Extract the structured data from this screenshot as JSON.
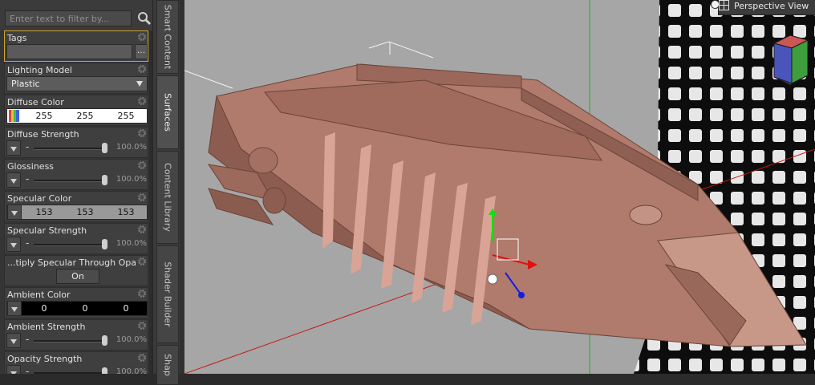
{
  "filter": {
    "placeholder": "Enter text to filter by..."
  },
  "properties": {
    "tags": {
      "label": "Tags",
      "button_label": "..."
    },
    "lighting_model": {
      "label": "Lighting Model",
      "value": "Plastic"
    },
    "diffuse_color": {
      "label": "Diffuse Color",
      "r": "255",
      "g": "255",
      "b": "255",
      "bg": "#ffffff",
      "fg": "#111111"
    },
    "diffuse_strength": {
      "label": "Diffuse Strength",
      "value": "100.0%",
      "level": 1.0
    },
    "glossiness": {
      "label": "Glossiness",
      "value": "100.0%",
      "level": 1.0
    },
    "specular_color": {
      "label": "Specular Color",
      "r": "153",
      "g": "153",
      "b": "153",
      "bg": "#999999",
      "fg": "#111111"
    },
    "specular_strength": {
      "label": "Specular Strength",
      "value": "100.0%",
      "level": 1.0
    },
    "multiply_specular": {
      "label": "...tiply Specular Through Opacity",
      "value": "On"
    },
    "ambient_color": {
      "label": "Ambient Color",
      "r": "0",
      "g": "0",
      "b": "0",
      "bg": "#000000",
      "fg": "#f0f0f0"
    },
    "ambient_strength": {
      "label": "Ambient Strength",
      "value": "100.0%",
      "level": 1.0
    },
    "opacity_strength": {
      "label": "Opacity Strength",
      "value": "100.0%",
      "level": 1.0
    }
  },
  "tabs": [
    {
      "label": "Smart Content",
      "active": false
    },
    {
      "label": "Surfaces",
      "active": true
    },
    {
      "label": "Content Library",
      "active": false
    },
    {
      "label": "Shader Builder",
      "active": false
    },
    {
      "label": "Shap",
      "active": false
    }
  ],
  "viewport": {
    "camera_label": "Perspective View",
    "model_color": "#b07a6c",
    "background_color": "#a6a6a6"
  },
  "icons": {
    "filter": "search-icon",
    "property_menu": "gear-icon",
    "color_picker": "color-swatch-icon",
    "stepper": "stepper-arrow-icon",
    "view": "view-layout-icon",
    "transform": "transform-gizmo-icon",
    "navigation": "view-cube-icon"
  },
  "accent_color": "#d2a431"
}
